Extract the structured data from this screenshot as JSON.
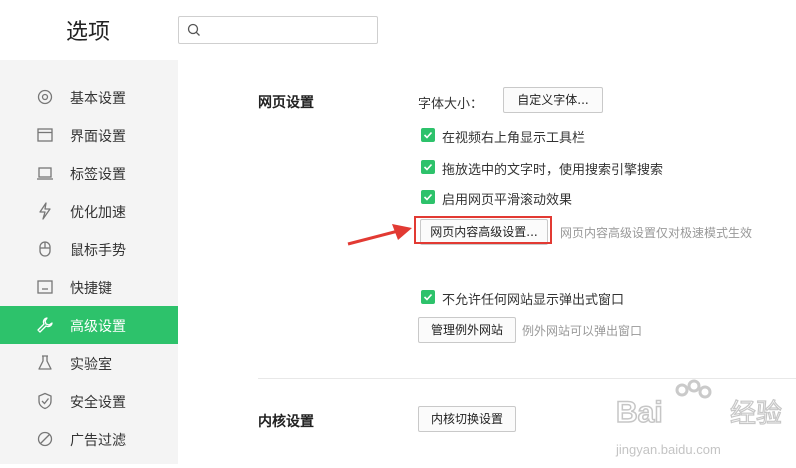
{
  "header": {
    "title": "选项",
    "search_placeholder": ""
  },
  "sidebar": {
    "items": [
      {
        "label": "基本设置",
        "icon": "gear-icon"
      },
      {
        "label": "界面设置",
        "icon": "window-icon"
      },
      {
        "label": "标签设置",
        "icon": "tab-icon"
      },
      {
        "label": "优化加速",
        "icon": "lightning-icon"
      },
      {
        "label": "鼠标手势",
        "icon": "mouse-icon"
      },
      {
        "label": "快捷键",
        "icon": "keyboard-icon"
      },
      {
        "label": "高级设置",
        "icon": "wrench-icon",
        "active": true
      },
      {
        "label": "实验室",
        "icon": "flask-icon"
      },
      {
        "label": "安全设置",
        "icon": "shield-icon"
      },
      {
        "label": "广告过滤",
        "icon": "block-icon"
      }
    ]
  },
  "web_settings": {
    "section_title": "网页设置",
    "font_size_label": "字体大小：",
    "custom_font_button": "自定义字体...",
    "checkboxes": [
      {
        "label": "在视频右上角显示工具栏",
        "checked": true
      },
      {
        "label": "拖放选中的文字时，使用搜索引擎搜索",
        "checked": true
      },
      {
        "label": "启用网页平滑滚动效果",
        "checked": true
      }
    ],
    "advanced_button": "网页内容高级设置...",
    "advanced_hint": "网页内容高级设置仅对极速模式生效",
    "popup_checkbox": {
      "label": "不允许任何网站显示弹出式窗口",
      "checked": true
    },
    "exceptions_button": "管理例外网站",
    "exceptions_hint": "例外网站可以弹出窗口"
  },
  "kernel_settings": {
    "section_title": "内核设置",
    "switch_button": "内核切换设置"
  },
  "watermark": {
    "text": "Baidu经验",
    "url": "jingyan.baidu.com"
  },
  "colors": {
    "accent": "#2dc26b",
    "highlight": "#e23a33"
  }
}
